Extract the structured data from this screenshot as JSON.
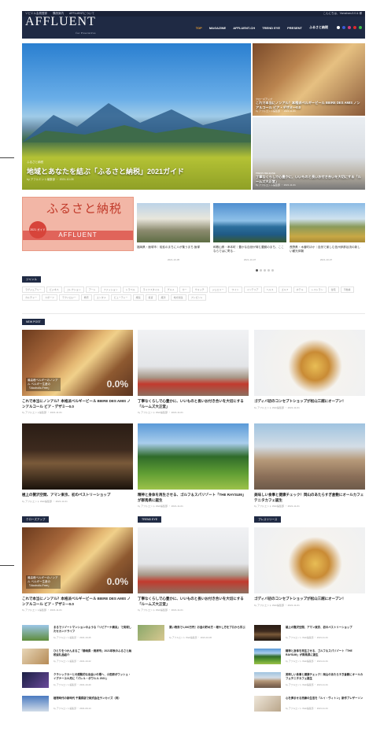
{
  "topbar": {
    "links": [
      "ソビエル会員登録",
      "購読案内",
      "AFFLUENTについて"
    ],
    "right": "こんにちは、Yamaharu3.0.& 様"
  },
  "header": {
    "logo": "AFFLUENT",
    "logo_sub": "for Executive",
    "nav": [
      "TOP",
      "MAGAZINE",
      "AFFLUENT-CH",
      "TREND EYE",
      "PRESENT",
      "ふるさと納税"
    ]
  },
  "hero": {
    "main": {
      "tag": "ふるさと納税",
      "title": "地域とあなたを結ぶ「ふるさと納税」2021ガイド",
      "meta": "by アフルエント編集部 ・ 2021-10-05"
    },
    "side": [
      {
        "tag": "クローズアップ",
        "title": "これで本当にノンアル？本格派ベルギービール BIERE DES AMIS ノンアルコール ビア・デザミ—0.0",
        "meta": "by アフルエント編集部 ・ 2021-11-01"
      },
      {
        "tag": "PRESS RELEASE",
        "title": "丁寧なくらしで心豊かに、いいものと長いお付き合いを大切にする「ルームズ大正堂」",
        "meta": "by アフルエント編集部 ・ 2021-11-01"
      }
    ]
  },
  "carousel": {
    "furusato": {
      "title": "ふるさと納税",
      "badge": "2021 ガイド",
      "band": "AFFLUENT"
    },
    "items": [
      {
        "title": "福岡県・飯塚市｜炭鉱のまちに人が集うまち 飯塚",
        "meta": "2021-10-05"
      },
      {
        "title": "和歌山県・串本町｜豊かな自然が育む豊饒のまち、ここならではに寄る...",
        "meta": "2021-10-07"
      },
      {
        "title": "長野県・木曽町ほか｜自然で楽しむ信州伊那谷流の新しい観光体験",
        "meta": "2021-10-07"
      }
    ]
  },
  "genre": {
    "label": "ジャンル",
    "tags": [
      "ラグジュアリー",
      "ビジネス",
      "コレクション",
      "アート",
      "ファッション",
      "トラベル",
      "ライフスタイル",
      "グルメ",
      "カー",
      "ウォッチ",
      "ジュエリー",
      "ワイン",
      "インテリア",
      "ヘルス",
      "ゴルフ",
      "ホテル",
      "レストラン",
      "住宅",
      "不動産",
      "カルチャー",
      "スポーツ",
      "テクノロジー",
      "教育",
      "エンタメ",
      "ビューティー",
      "旅館",
      "投資",
      "経済",
      "地方創生",
      "プレゼント"
    ]
  },
  "new_post": {
    "label": "NEW POST",
    "cards": [
      {
        "title": "これで本当にノンアル？本格派ベルギービール BIERE DES AMIS ノンアルコール ビア・デザミ—0.0",
        "meta": "by アフルエント編集部 ・ 2021-11-01",
        "overlay": "最高峰ベルギーのノンアル ベルギー生産の「Alcoholic-Free」",
        "badge": "0.0%"
      },
      {
        "title": "丁寧なくらしで心豊かに、いいものと長いお付き合いを大切にする「ルームズ大正堂」",
        "meta": "by アフルエント Web編集部 ・ 2021-11-01"
      },
      {
        "title": "ゴディバ初のコンセプトショップが松山三越にオープン！",
        "meta": "by アフルエント Web編集部 ・ 2021-11-01"
      },
      {
        "title": "極上の贅沢空間、アマン東京、初のペストリーショップ",
        "meta": "by アフルエント Web編集部 ・ 2021-11-01"
      },
      {
        "title": "精神と身体を再生させる、ゴルフ＆スパリゾート「THE RAYSUM」が群馬県に誕生",
        "meta": "by アフルエント Web編集部 ・ 2021-11-01"
      },
      {
        "title": "美味しい食事と健康チェック！岡山のあたらすぎ倉敷にオールカフェテニタカフェ誕生",
        "meta": "by アフルエント Web編集部 ・ 2021-11-01"
      }
    ]
  },
  "columns": [
    {
      "label": "クローズアップ",
      "big": {
        "title": "これで本当にノンアル？本格派ベルギービール BIERE DES AMIS ノンアルコール ビア・デザミ—0.0",
        "meta": "by アフルエント編集部 ・ 2021-11-01"
      },
      "minis": [
        {
          "title": "まるでリゾートマンションのような「リビアーナ横浜」 で実現したセカンドライフ",
          "meta": "by アフルエント編集部 ・ 2021-10-26"
        },
        {
          "title": "ひとりをつかんまるご「静岡県・焼津市」2021年秋のふるさと納税返礼品紹介",
          "meta": "by アフルエント編集部 ・ 2021-10-22"
        },
        {
          "title": "クラシックカーとの感動的な出会いの場へ、小田原ボワッシュ・イグナーユ11月に「パレル・ボワルル 2021」",
          "meta": "by アフルエント編集部 ・ 2021-10-20"
        },
        {
          "title": "植物時代の新時代 千葉県版で株式会社ランカイズ（同）",
          "meta": "by アフルエント編集部 ・ 2021-09-14"
        }
      ]
    },
    {
      "label": "TREND EYE",
      "big": {
        "title": "丁寧なくらしで心豊かに、いいものと長いお付き合いを大切にする「ルームズ大正堂」",
        "meta": "by アフルエント Web編集部 ・ 2021-11-01"
      },
      "minis": [
        {
          "title": "買い物券で1,000万円！お金の貯め方・増やし方をプロから学ぶ",
          "meta": "by アフルエント Web編集部 ・ 2021-10-30"
        }
      ]
    },
    {
      "label": "プレスリリース",
      "big": {
        "title": "ゴディバ初のコンセプトショップが松山三越にオープン！",
        "meta": "by アフルエント Web編集部 ・ 2021-11-01"
      },
      "minis": [
        {
          "title": "極上の贅沢空間、アマン東京、初のペストリーショップ",
          "meta": "by アフルエント Web編集部 ・ 2021-11-01"
        },
        {
          "title": "精神と身体を再生させる、ゴルフ＆スパリゾート「THE RAYSUM」が群馬県に誕生",
          "meta": "by アフルエント Web編集部 ・ 2021-11-01"
        },
        {
          "title": "美味しい食事と健康チェック！岡山のあたらすぎ倉敷にオールカフェテニタカフェ誕生",
          "meta": "by アフルエント Web編集部 ・ 2021-11-01"
        },
        {
          "title": "心を弾ませる洗練の生活を「ルイ・ヴィトン」新作ブレザーソン",
          "meta": "by アフルエント Web編集部 ・ 2021-11-01"
        }
      ]
    }
  ],
  "colors": {
    "navy": "#1f2a44",
    "accent": "#f0a030",
    "text": "#222222"
  }
}
